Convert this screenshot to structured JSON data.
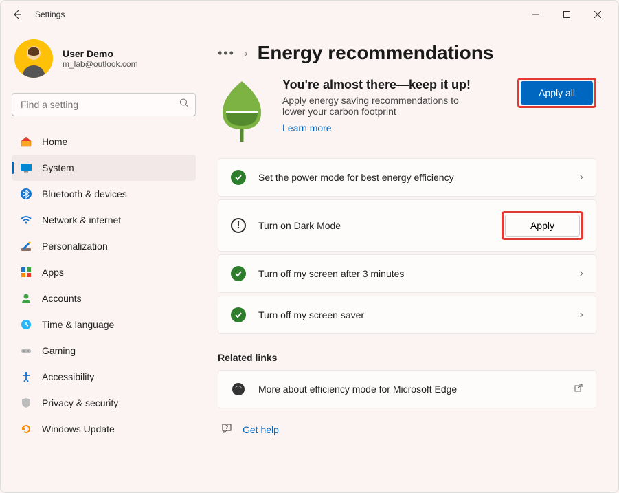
{
  "titlebar": {
    "title": "Settings"
  },
  "profile": {
    "name": "User Demo",
    "email": "m_lab@outlook.com"
  },
  "search": {
    "placeholder": "Find a setting"
  },
  "nav": [
    {
      "label": "Home",
      "key": "home"
    },
    {
      "label": "System",
      "key": "system"
    },
    {
      "label": "Bluetooth & devices",
      "key": "bluetooth"
    },
    {
      "label": "Network & internet",
      "key": "network"
    },
    {
      "label": "Personalization",
      "key": "personalization"
    },
    {
      "label": "Apps",
      "key": "apps"
    },
    {
      "label": "Accounts",
      "key": "accounts"
    },
    {
      "label": "Time & language",
      "key": "time"
    },
    {
      "label": "Gaming",
      "key": "gaming"
    },
    {
      "label": "Accessibility",
      "key": "accessibility"
    },
    {
      "label": "Privacy & security",
      "key": "privacy"
    },
    {
      "label": "Windows Update",
      "key": "update"
    }
  ],
  "breadcrumb": {
    "title": "Energy recommendations"
  },
  "hero": {
    "title": "You're almost there—keep it up!",
    "desc": "Apply energy saving recommendations to lower your carbon footprint",
    "learn_more": "Learn more",
    "apply_all": "Apply all"
  },
  "cards": [
    {
      "status": "done",
      "label": "Set the power mode for best energy efficiency"
    },
    {
      "status": "pending",
      "label": "Turn on Dark Mode",
      "apply": "Apply"
    },
    {
      "status": "done",
      "label": "Turn off my screen after 3 minutes"
    },
    {
      "status": "done",
      "label": "Turn off my screen saver"
    }
  ],
  "related": {
    "heading": "Related links",
    "edge": "More about efficiency mode for Microsoft Edge"
  },
  "gethelp": "Get help"
}
